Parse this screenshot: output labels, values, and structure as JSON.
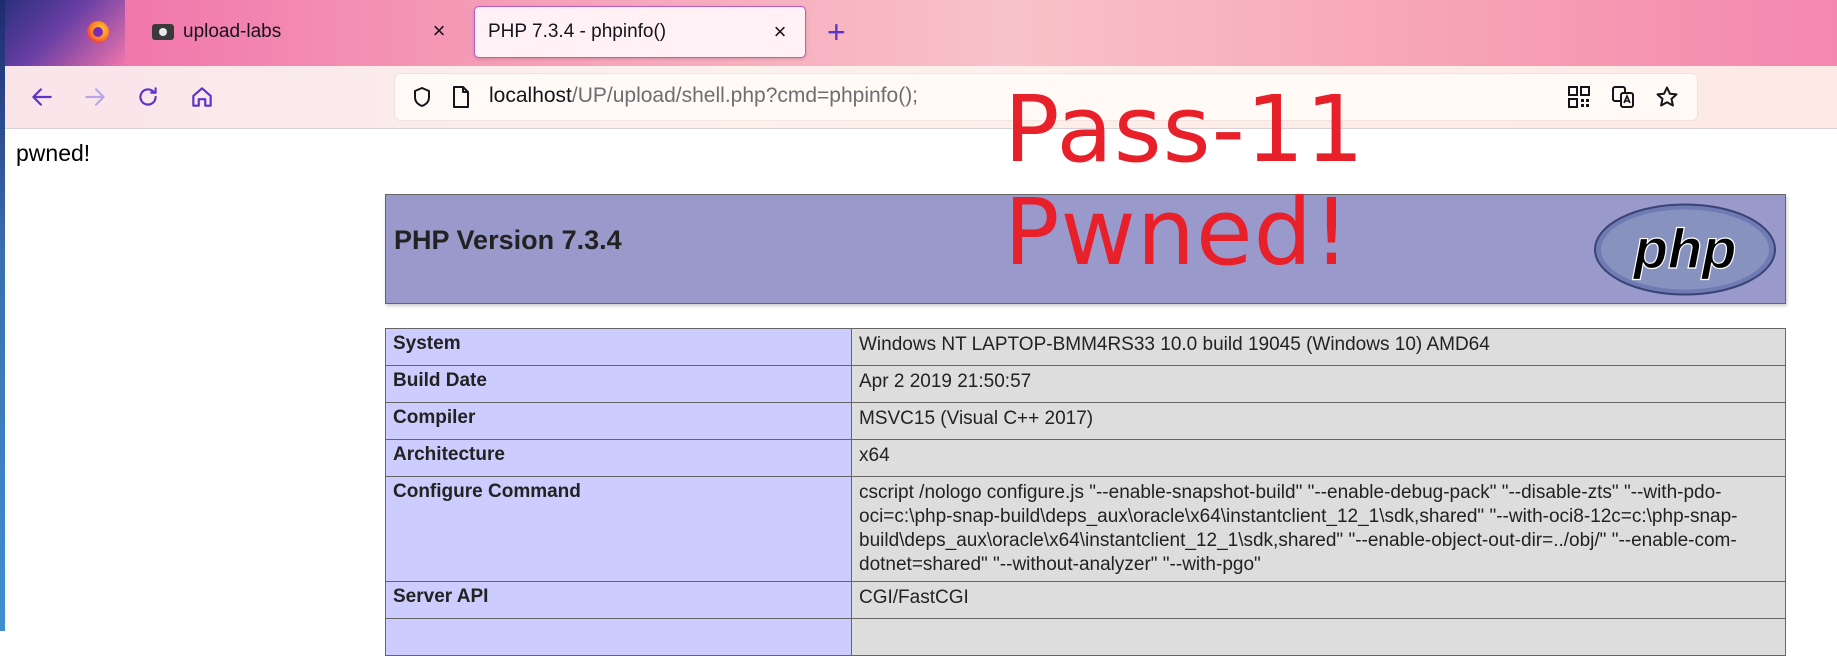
{
  "browser": {
    "tabs": [
      {
        "title": "upload-labs",
        "active": false
      },
      {
        "title": "PHP 7.3.4 - phpinfo()",
        "active": true
      }
    ],
    "close_symbol": "×",
    "new_tab_symbol": "+",
    "url_host": "localhost",
    "url_path": "/UP/upload/shell.php?cmd=phpinfo();",
    "nav_icons": [
      "back-icon",
      "forward-icon",
      "reload-icon",
      "home-icon"
    ],
    "url_icons": [
      "shield-icon",
      "page-icon",
      "qr-code-icon",
      "translate-icon",
      "bookmark-star-icon"
    ],
    "accent_color": "#5b35c7"
  },
  "page": {
    "pwned_text": "pwned!",
    "overlay_line1": "Pass-11",
    "overlay_line2": "Pwned!",
    "overlay_color": "#e8202a",
    "php_version_title": "PHP Version 7.3.4",
    "php_logo_text": "php",
    "info_rows": [
      {
        "key": "System",
        "value": "Windows NT LAPTOP-BMM4RS33 10.0 build 19045 (Windows 10) AMD64"
      },
      {
        "key": "Build Date",
        "value": "Apr 2 2019 21:50:57"
      },
      {
        "key": "Compiler",
        "value": "MSVC15 (Visual C++ 2017)"
      },
      {
        "key": "Architecture",
        "value": "x64"
      },
      {
        "key": "Configure Command",
        "value": "cscript /nologo configure.js \"--enable-snapshot-build\" \"--enable-debug-pack\" \"--disable-zts\" \"--with-pdo-oci=c:\\php-snap-build\\deps_aux\\oracle\\x64\\instantclient_12_1\\sdk,shared\" \"--with-oci8-12c=c:\\php-snap-build\\deps_aux\\oracle\\x64\\instantclient_12_1\\sdk,shared\" \"--enable-object-out-dir=../obj/\" \"--enable-com-dotnet=shared\" \"--without-analyzer\" \"--with-pgo\""
      },
      {
        "key": "Server API",
        "value": "CGI/FastCGI"
      },
      {
        "key": "",
        "value": ""
      }
    ],
    "header_bg": "#9999cc",
    "key_bg": "#ccccff",
    "value_bg": "#dddddd"
  }
}
